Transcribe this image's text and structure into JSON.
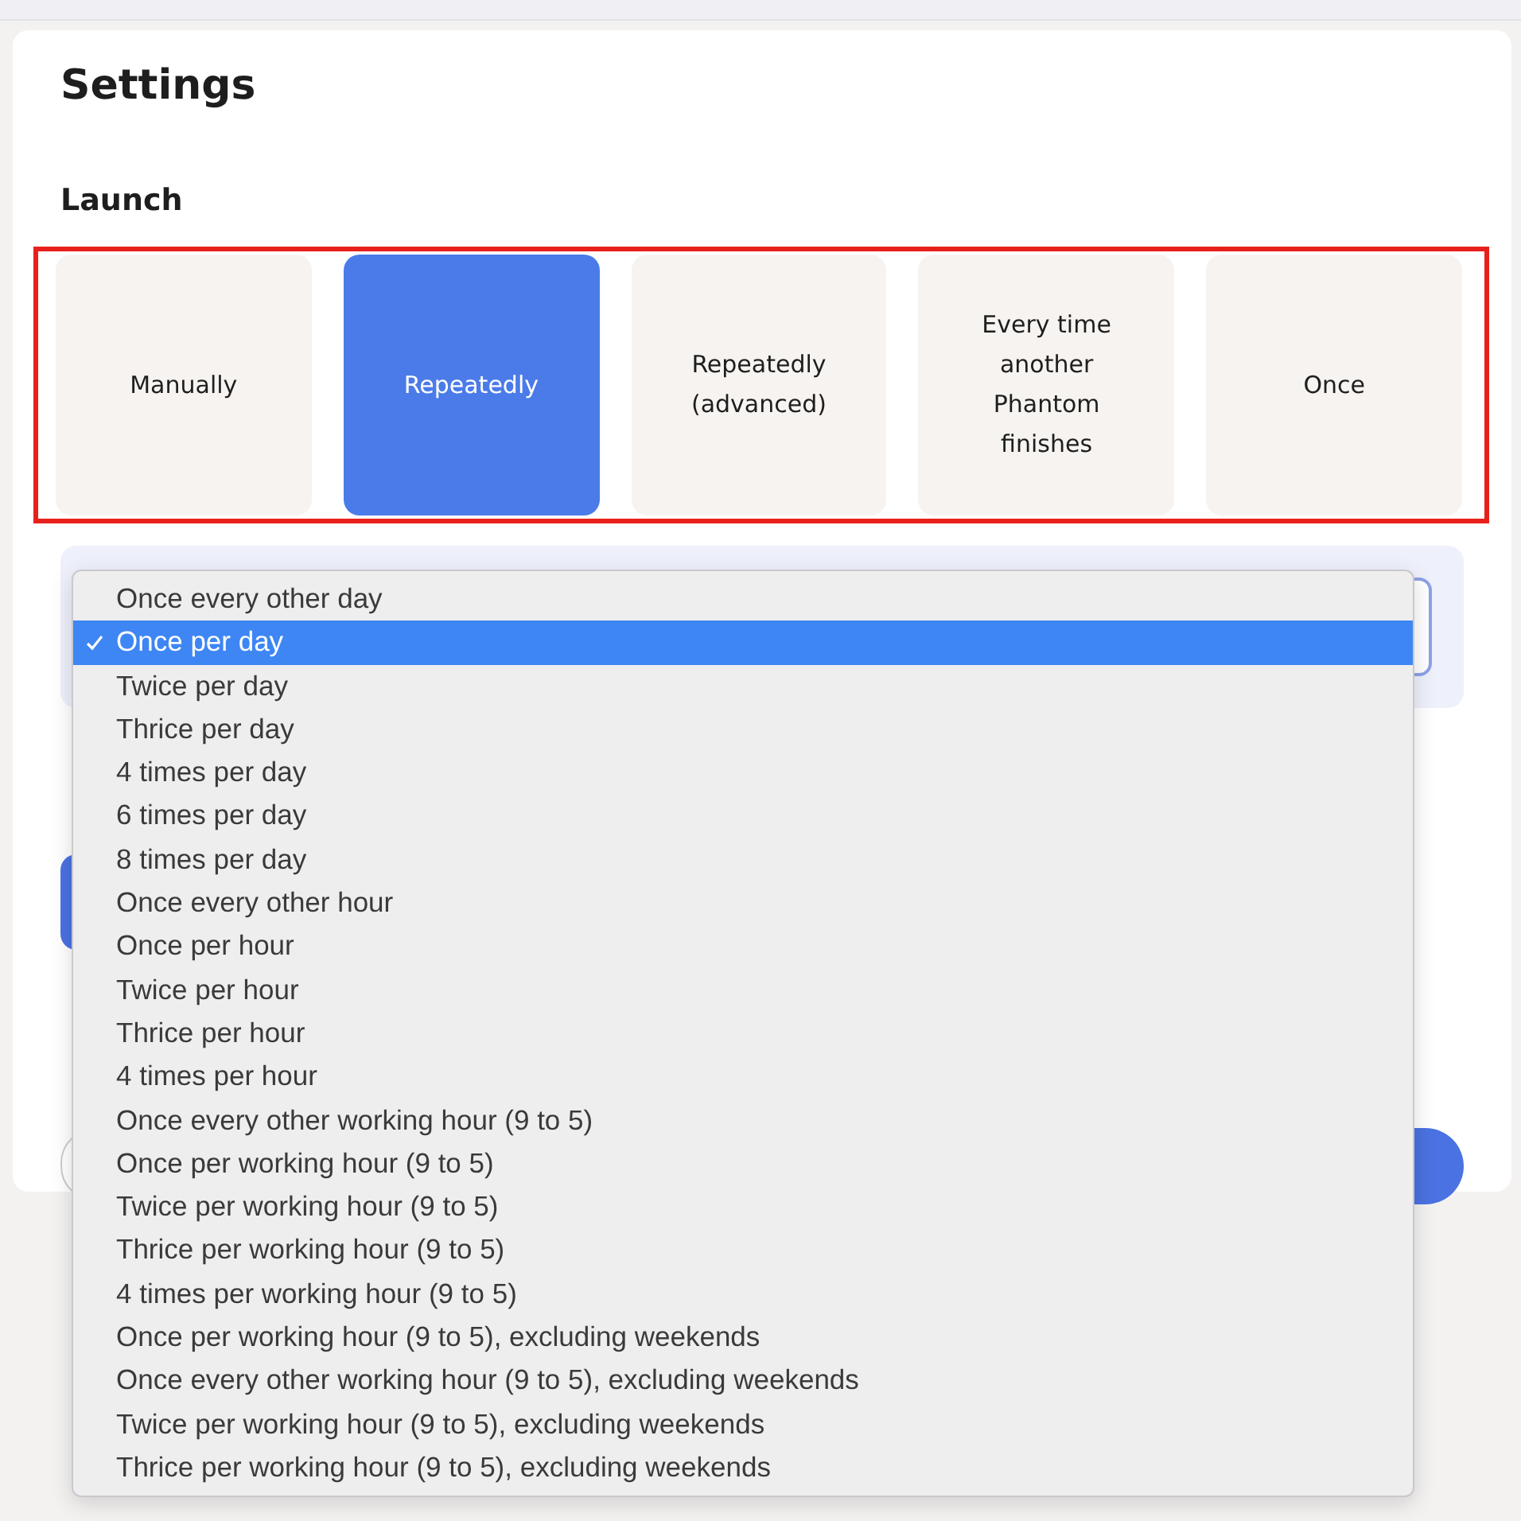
{
  "title": "Settings",
  "launch": {
    "heading": "Launch",
    "options": [
      {
        "label": "Manually",
        "selected": false
      },
      {
        "label": "Repeatedly",
        "selected": true
      },
      {
        "label": "Repeatedly (advanced)",
        "selected": false
      },
      {
        "label": "Every time another Phantom finishes",
        "selected": false
      },
      {
        "label": "Once",
        "selected": false
      }
    ]
  },
  "schedule_menu": {
    "options": [
      {
        "label": "Once every other day",
        "selected": false
      },
      {
        "label": "Once per day",
        "selected": true
      },
      {
        "label": "Twice per day",
        "selected": false
      },
      {
        "label": "Thrice per day",
        "selected": false
      },
      {
        "label": "4 times per day",
        "selected": false
      },
      {
        "label": "6 times per day",
        "selected": false
      },
      {
        "label": "8 times per day",
        "selected": false
      },
      {
        "label": "Once every other hour",
        "selected": false
      },
      {
        "label": "Once per hour",
        "selected": false
      },
      {
        "label": "Twice per hour",
        "selected": false
      },
      {
        "label": "Thrice per hour",
        "selected": false
      },
      {
        "label": "4 times per hour",
        "selected": false
      },
      {
        "label": "Once every other working hour (9 to 5)",
        "selected": false
      },
      {
        "label": "Once per working hour (9 to 5)",
        "selected": false
      },
      {
        "label": "Twice per working hour (9 to 5)",
        "selected": false
      },
      {
        "label": "Thrice per working hour (9 to 5)",
        "selected": false
      },
      {
        "label": "4 times per working hour (9 to 5)",
        "selected": false
      },
      {
        "label": "Once per working hour (9 to 5), excluding weekends",
        "selected": false
      },
      {
        "label": "Once every other working hour (9 to 5), excluding weekends",
        "selected": false
      },
      {
        "label": "Twice per working hour (9 to 5), excluding weekends",
        "selected": false
      },
      {
        "label": "Thrice per working hour (9 to 5), excluding weekends",
        "selected": false
      }
    ]
  }
}
